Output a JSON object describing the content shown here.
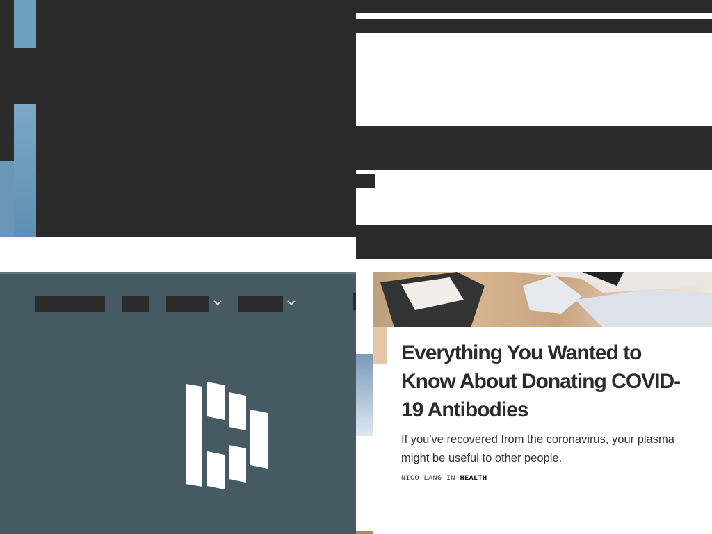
{
  "colors": {
    "dark": "#2b2b2b",
    "promo_bg": "#455a62",
    "text": "#2b2b2b",
    "white": "#ffffff"
  },
  "promo": {
    "logo_icon": "dashlane-logo-icon",
    "nav_dropdown_icons": [
      "chevron-down-icon",
      "chevron-down-icon"
    ]
  },
  "article": {
    "title": "Everything You Wanted to Know About Donating COVID-19 Antibodies",
    "summary": "If you've recovered from the coronavirus, your plasma might be useful to other people.",
    "author": "NICO LANG",
    "in_label": "IN",
    "category": "HEALTH"
  }
}
